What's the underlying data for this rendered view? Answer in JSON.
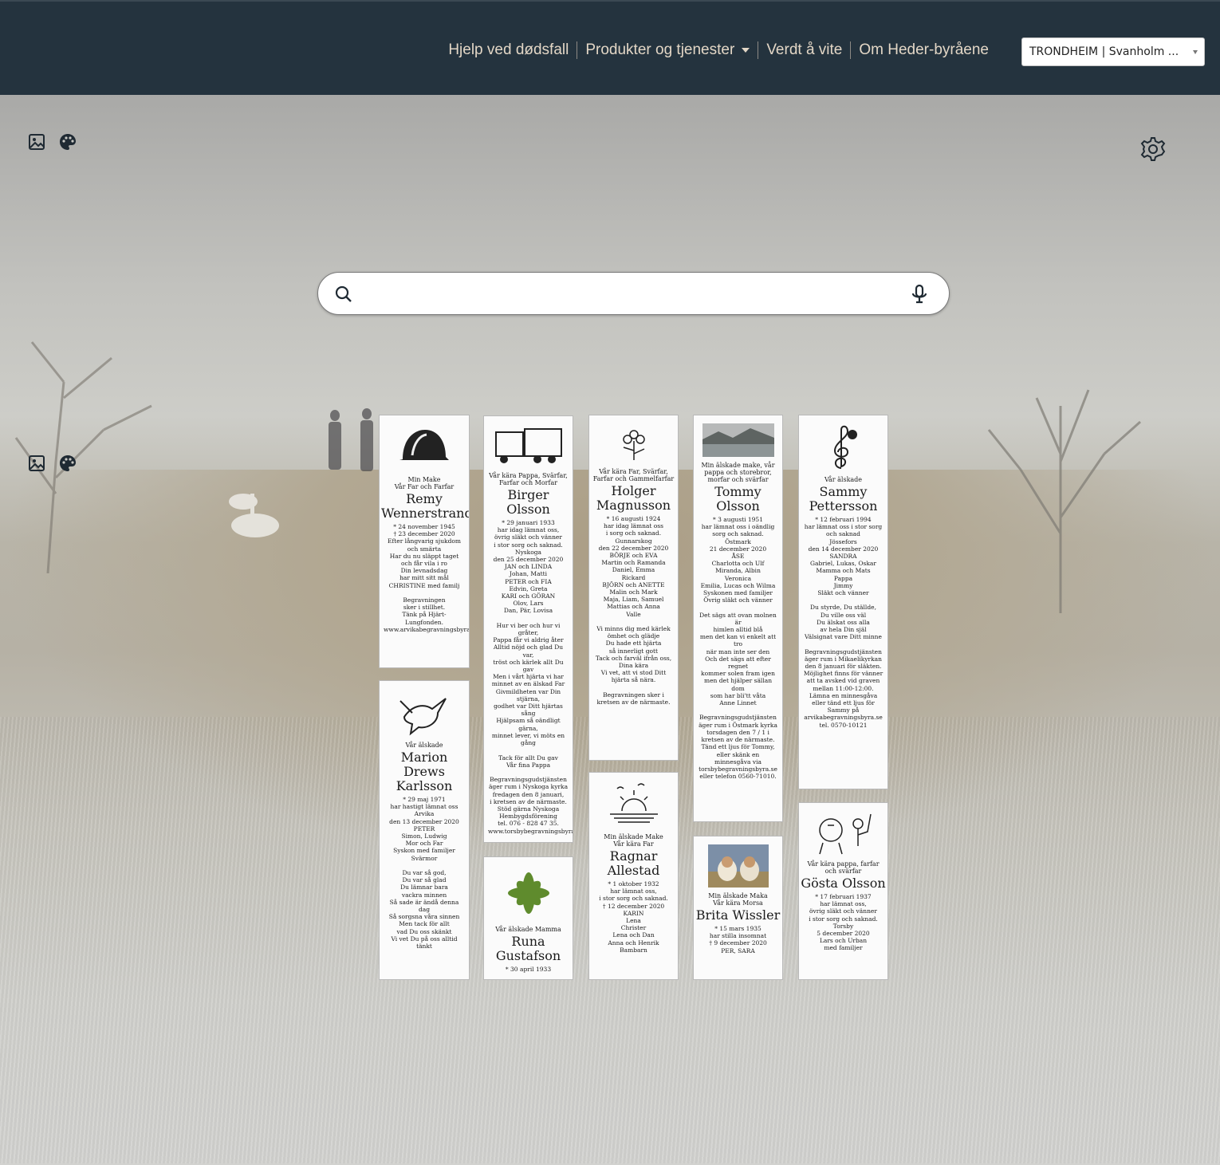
{
  "nav": {
    "items": [
      "Hjelp ved dødsfall",
      "Produkter og tjenester",
      "Verdt å vite",
      "Om Heder-byråene"
    ],
    "agency_select": "TRONDHEIM | Svanholm ..."
  },
  "search": {
    "placeholder": ""
  },
  "icons": {
    "image": "image-icon",
    "palette": "palette-icon",
    "settings": "gear-icon",
    "search": "search-icon",
    "mic": "microphone-icon"
  },
  "cards": [
    {
      "pre": "Min Make\nVår Far och Farfar",
      "name": "Remy\nWennerstrand",
      "body": "* 24 november 1945\n† 23 december 2020\nEfter långvarig sjukdom\noch smärta\nHar du nu släppt taget\noch får vila i ro\nDin levnadsdag\nhar mitt sitt mål\nCHRISTINE med familj\n\nBegravningen\nsker i stillhet.\nTänk på Hjärt-\nLungfonden.\nwww.arvikabegravningsbyra.se"
    },
    {
      "pre": "Vår älskade",
      "name": "Marion\nDrews\nKarlsson",
      "body": "* 29 maj 1971\nhar hastigt lämnat oss\nArvika\nden 13 december 2020\nPETER\nSimon, Ludwig\nMor och Far\nSyskon med familjer\nSvärmor\n\nDu var så god,\nDu var så glad\nDu lämnar bara\nvackra minnen\nSå sade är ändå denna dag\nSå sorgsna våra sinnen\nMen tack för allt\nvad Du oss skänkt\nVi vet Du på oss alltid tänkt"
    },
    {
      "pre": "Vår kära Pappa, Svärfar,\nFarfar och Morfar",
      "name": "Birger Olsson",
      "body": "* 29 januari 1933\nhar idag lämnat oss,\növrig släkt och vänner\ni stor sorg och saknad.\nNyskoga\nden 25 december 2020\nJAN och LINDA\nJohan, Matti\nPETER och FIA\nEdvin, Greta\nKARI och GÖRAN\nOlov, Lars\nDan, Pär, Lovisa\n\nHur vi ber och hur vi gråter,\nPappa får vi aldrig åter\nAlltid nöjd och glad Du var,\ntröst och kärlek allt Du gav\nMen i vårt hjärta vi har\nminnet av en älskad Far\nGivmildheten var Din\nstjärna,\ngodhet var Ditt hjärtas sång\nHjälpsam så oändligt gärna,\nminnet lever, vi möts en\ngång\n\nTack för allt Du gav\nVår fina Pappa\n\nBegravningsgudstjänsten\näger rum i Nyskoga kyrka\nfredagen den 8 januari,\ni kretsen av de närmaste.\nStöd gärna Nyskoga\nHembygdsförening\ntel. 076 - 828 47 35.\nwww.torsbybegravningsbyra.se"
    },
    {
      "pre": "Vår älskade Mamma",
      "name": "Runa\nGustafson",
      "body": "* 30 april 1933"
    },
    {
      "pre": "Vår kära Far, Svärfar,\nFarfar och Gammelfarfar",
      "name": "Holger\nMagnusson",
      "body": "* 16 augusti 1924\nhar idag lämnat oss\ni sorg och saknad.\nGunnarskog\nden 22 december 2020\nBÖRJE och EVA\nMartin och Ramanda\nDaniel, Emma\nRickard\nBJÖRN och ANETTE\nMalin och Mark\nMaja, Liam, Samuel\nMattias och Anna\nValle\n\nVi minns dig med kärlek\nömhet och glädje\nDu hade ett hjärta\nså innerligt gott\nTack och farväl ifrån oss,\nDina kära\nVi vet, att vi stod Ditt\nhjärta så nära.\n\nBegravningen sker i\nkretsen av de närmaste."
    },
    {
      "pre": "Min älskade Make\nVår kära Far",
      "name": "Ragnar\nAllestad",
      "body": "* 1 oktober 1932\nhar lämnat oss,\ni stor sorg och saknad.\n† 12 december 2020\nKARIN\nLena\nChrister\nLena och Dan\nAnna och Henrik\nBambarn"
    },
    {
      "pre": "Min älskade make, vår\npappa och storebror,\nmorfar och svärfar",
      "name": "Tommy\nOlsson",
      "body": "* 3 augusti 1951\nhar lämnat oss i oändlig\nsorg och saknad.\nÖstmark\n21 december 2020\nÅSE\nCharlotta och Ulf\nMiranda, Albin\nVeronica\nEmilia, Lucas och Wilma\nSyskonen med familjer\nÖvrig släkt och vänner\n\nDet sägs att ovan molnen är\nhimlen alltid blå\nmen det kan vi enkelt att tro\nnär man inte ser den\nOch det sägs att efter regnet\nkommer solen fram igen\nmen det hjälper sällan dom\nsom har bli'tt våta\nAnne Linnet\n\nBegravningsgudstjänsten\näger rum i Östmark kyrka\ntorsdagen den 7 / 1 i\nkretsen av de närmaste.\nTänd ett ljus för Tommy,\neller skänk en\nminnesgåva via\ntorsbybegravningsbyra.se\neller telefon 0560-71010."
    },
    {
      "pre": "Min älskade Maka\nVår kära Morsa",
      "name": "Brita Wissler",
      "body": "* 15 mars 1935\nhar stilla insomnat\n† 9 december 2020\nPER, SARA"
    },
    {
      "pre": "Vår älskade",
      "name": "Sammy\nPettersson",
      "body": "* 12 februari 1994\nhar lämnat oss i stor sorg\noch saknad\nJössefors\nden 14 december 2020\nSANDRA\nGabriel, Lukas, Oskar\nMamma och Mats\nPappa\nJimmy\nSläkt och vänner\n\nDu styrde, Du ställde,\nDu ville oss väl\nDu älskat oss alla\nav hela Din själ\nVälsignat vare Ditt minne\n\nBegravningsgudstjänsten\näger rum i Mikaelikyrkan\nden 8 januari för släkten.\nMöjlighet finns för vänner\natt ta avsked vid graven\nmellan 11:00-12:00.\nLämna en minnesgåva\neller tänd ett ljus för\nSammy på\narvikabegravningsbyra.se\ntel. 0570-10121"
    },
    {
      "pre": "Vår kära pappa, farfar\noch svärfar",
      "name": "Gösta Olsson",
      "body": "* 17 februari 1937\nhar lämnat oss,\növrig släkt och vänner\ni stor sorg och saknad.\nTorsby\n5 december 2020\nLars och Urban\nmed familjer"
    }
  ]
}
